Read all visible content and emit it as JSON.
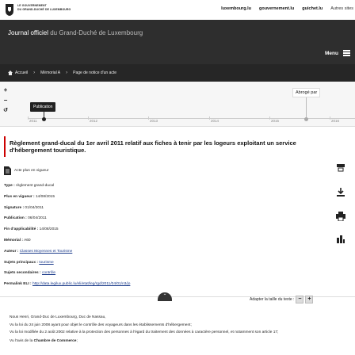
{
  "header": {
    "gov_logo_text": [
      "LE GOUVERNEMENT",
      "DU GRAND-DUCHÉ DE LUXEMBOURG"
    ],
    "links": [
      "luxembourg.lu",
      "gouvernement.lu",
      "guichet.lu"
    ],
    "other_sites": "Autres sites"
  },
  "banner": {
    "title_main": "Journal officiel",
    "title_rest": " du Grand-Duché de Luxembourg",
    "menu_label": "Menu"
  },
  "breadcrumb": [
    "Accueil",
    "Mémorial A",
    "Page de notice d'un acte"
  ],
  "timeline": {
    "zoom_in": "+",
    "zoom_out": "−",
    "reset": "↺",
    "years": [
      "2011",
      "2012",
      "2013",
      "2014",
      "2015",
      "2016"
    ],
    "publication_label": "Publication",
    "abroge_label": "Abrogé par"
  },
  "doc": {
    "title": "Règlement grand-ducal du 1er avril 2011 relatif aux fiches à tenir par les logeurs exploitant un service d'hébergement touristique.",
    "status": "Acte plus en vigueur",
    "meta": [
      {
        "key": "Type :",
        "value": " règlement grand-ducal"
      },
      {
        "key": "Plus en vigueur :",
        "value": " 14/08/2015"
      },
      {
        "key": "Signature :",
        "value": " 01/04/2011"
      },
      {
        "key": "Publication :",
        "value": " 06/04/2011"
      },
      {
        "key": "Fin d'applicabilité :",
        "value": " 14/08/2015"
      },
      {
        "key": "Mémorial :",
        "value": " A60"
      }
    ],
    "auteur_key": "Auteur :",
    "auteur_value": "Classes Moyennes et Tourisme",
    "sujets_principaux_key": "Sujets principaux :",
    "sujets_principaux_value": "tourisme",
    "sujets_secondaires_key": "Sujets secondaires :",
    "sujets_secondaires_value": "contrôle",
    "permalink_key": "Permalink ELI :",
    "permalink_value": "http://data.legilux.public.lu/eli/etat/leg/rgd/2011/04/01/n3/jo"
  },
  "textsize": {
    "label": "Adapter la taille du texte :",
    "minus": "−",
    "plus": "+"
  },
  "body": {
    "line1": "Nous Henri, Grand-Duc de Luxembourg, Duc de Nassau,",
    "line2": "Vu la loi du 24 juin 2008 ayant pour objet le contrôle des voyageurs dans les établissements d'hébergement;",
    "line3": "Vu la loi modifiée du 2 août 2002 relative à la protection des personnes à l'égard du traitement des données à caractère personnel, et notamment son article 17;",
    "line4_prefix": "Vu l'avis de la ",
    "line4_bold": "Chambre de Commerce",
    "line4_suffix": ";"
  }
}
